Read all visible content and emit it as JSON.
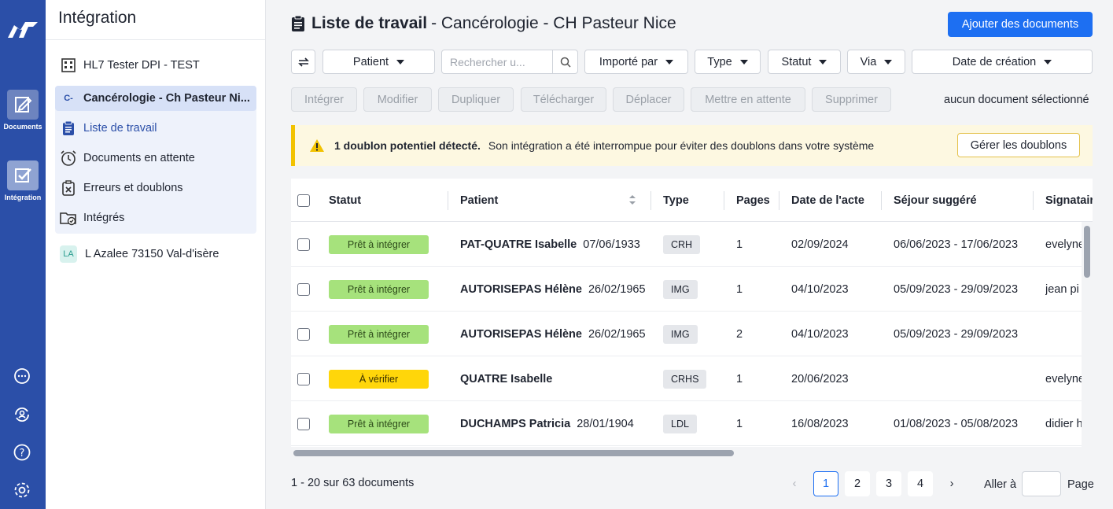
{
  "rail": {
    "nav": [
      {
        "label": "Documents",
        "icon": "document-edit-icon"
      },
      {
        "label": "Intégration",
        "icon": "integration-check-icon"
      }
    ],
    "bottom_icons": [
      "chat-icon",
      "sync-user-icon",
      "help-icon",
      "settings-icon"
    ]
  },
  "sidebar": {
    "title": "Intégration",
    "top_item": "HL7 Tester DPI - TEST",
    "selected_badge": "C-",
    "selected_item": "Cancérologie - Ch Pasteur Ni...",
    "sub_items": [
      {
        "label": "Liste de travail",
        "icon": "clipboard-icon"
      },
      {
        "label": "Documents en attente",
        "icon": "alarm-clock-icon"
      },
      {
        "label": "Erreurs et doublons",
        "icon": "error-clipboard-icon"
      },
      {
        "label": "Intégrés",
        "icon": "folder-check-icon"
      }
    ],
    "other_badge": "LA",
    "other_item": "L Azalee 73150 Val-d'isère"
  },
  "header": {
    "title_bold": "Liste de travail",
    "title_rest": "- Cancérologie - CH Pasteur Nice",
    "add_button": "Ajouter des documents"
  },
  "filters": {
    "patient": "Patient",
    "search_placeholder": "Rechercher u...",
    "imported_by": "Importé par",
    "type": "Type",
    "status": "Statut",
    "via": "Via",
    "created": "Date de création"
  },
  "actions": {
    "integrate": "Intégrer",
    "modify": "Modifier",
    "duplicate": "Dupliquer",
    "download": "Télécharger",
    "move": "Déplacer",
    "hold": "Mettre en attente",
    "delete": "Supprimer",
    "selection_status": "aucun document sélectionné"
  },
  "alert": {
    "bold": "1 doublon potentiel détecté.",
    "text": "Son intégration a été interrompue pour éviter des doublons dans votre système",
    "button": "Gérer les doublons",
    "color": "#f2c200"
  },
  "table": {
    "headers": {
      "status": "Statut",
      "patient": "Patient",
      "type": "Type",
      "pages": "Pages",
      "act_date": "Date de l'acte",
      "stay": "Séjour suggéré",
      "signer": "Signatair"
    },
    "rows": [
      {
        "status": "Prêt à intégrer",
        "status_kind": "ok",
        "patient": "PAT-QUATRE Isabelle",
        "dob": "07/06/1933",
        "type": "CRH",
        "pages": "1",
        "act_date": "02/09/2024",
        "stay": "06/06/2023 - 17/06/2023",
        "signer": "evelyne"
      },
      {
        "status": "Prêt à intégrer",
        "status_kind": "ok",
        "patient": "AUTORISEPAS Hélène",
        "dob": "26/02/1965",
        "type": "IMG",
        "pages": "1",
        "act_date": "04/10/2023",
        "stay": "05/09/2023 - 29/09/2023",
        "signer": "jean pi"
      },
      {
        "status": "Prêt à intégrer",
        "status_kind": "ok",
        "patient": "AUTORISEPAS Hélène",
        "dob": "26/02/1965",
        "type": "IMG",
        "pages": "2",
        "act_date": "04/10/2023",
        "stay": "05/09/2023 - 29/09/2023",
        "signer": ""
      },
      {
        "status": "À vérifier",
        "status_kind": "check",
        "patient": "QUATRE Isabelle",
        "dob": "",
        "type": "CRHS",
        "pages": "1",
        "act_date": "20/06/2023",
        "stay": "",
        "signer": "evelyne"
      },
      {
        "status": "Prêt à intégrer",
        "status_kind": "ok",
        "patient": "DUCHAMPS Patricia",
        "dob": "28/01/1904",
        "type": "LDL",
        "pages": "1",
        "act_date": "16/08/2023",
        "stay": "01/08/2023 - 05/08/2023",
        "signer": "didier h"
      }
    ]
  },
  "footer": {
    "count": "1 - 20 sur 63 documents",
    "prev": "‹",
    "pages": [
      "1",
      "2",
      "3",
      "4"
    ],
    "next": "›",
    "goto": "Aller à",
    "page_label": "Page"
  },
  "colors": {
    "rail": "#2b4fa8",
    "primary": "#1d6ff2",
    "ready": "#a6e27c",
    "check": "#ffd60a"
  }
}
